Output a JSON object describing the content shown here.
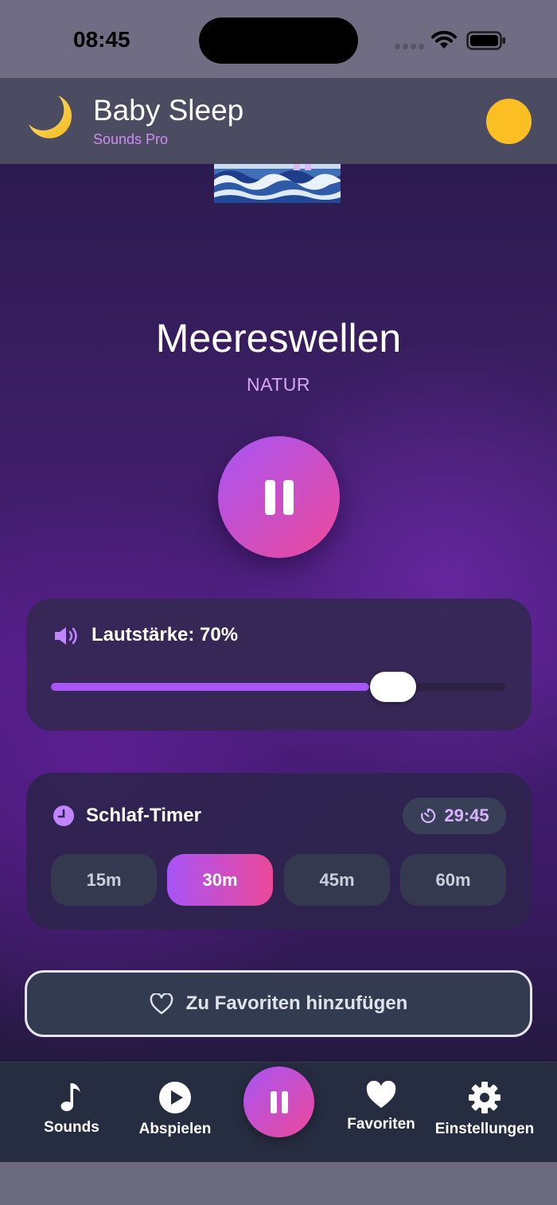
{
  "status_bar": {
    "time": "08:45",
    "icons": [
      "signal-dots-icon",
      "wifi-icon",
      "battery-icon"
    ]
  },
  "header": {
    "logo_icon": "moon-icon",
    "title": "Baby Sleep",
    "subtitle": "Sounds Pro",
    "avatar_color": "#fbbf24"
  },
  "player": {
    "artwork_icon": "wave-artwork",
    "title": "Meereswellen",
    "category": "NATUR",
    "state": "playing",
    "control_icon": "pause-icon"
  },
  "volume": {
    "icon": "speaker-icon",
    "label": "Lautstärke: 70%",
    "level_percent": 70
  },
  "timer": {
    "icon": "clock-icon",
    "label": "Schlaf-Timer",
    "countdown_icon": "timer-icon",
    "remaining": "29:45",
    "options": [
      {
        "label": "15m",
        "active": false
      },
      {
        "label": "30m",
        "active": true
      },
      {
        "label": "45m",
        "active": false
      },
      {
        "label": "60m",
        "active": false
      }
    ]
  },
  "favorite": {
    "icon": "heart-outline-icon",
    "label": "Zu Favoriten hinzufügen"
  },
  "nav": {
    "items": [
      {
        "label": "Sounds",
        "icon": "music-note-icon"
      },
      {
        "label": "Abspielen",
        "icon": "play-circle-icon"
      },
      {
        "label": "Favoriten",
        "icon": "heart-icon"
      },
      {
        "label": "Einstellungen",
        "icon": "gear-icon"
      }
    ],
    "center_icon": "pause-icon"
  },
  "colors": {
    "accent_start": "#a855f7",
    "accent_end": "#ec4899",
    "category_text": "#d7a6f6"
  }
}
